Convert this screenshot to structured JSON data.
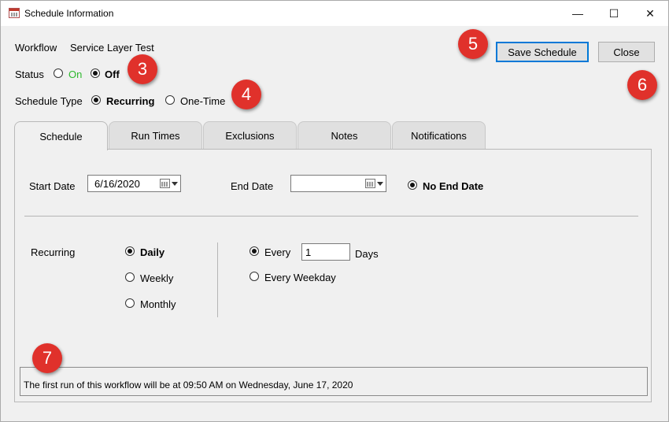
{
  "window": {
    "title": "Schedule Information",
    "controls": {
      "minimize": "—",
      "maximize": "☐",
      "close": "✕"
    }
  },
  "header": {
    "workflow_label": "Workflow",
    "workflow_value": "Service Layer Test",
    "status_label": "Status",
    "status_options": {
      "on": "On",
      "off": "Off"
    },
    "status_selected": "off",
    "schedule_type_label": "Schedule Type",
    "schedule_type_options": {
      "recurring": "Recurring",
      "one_time": "One-Time"
    },
    "schedule_type_selected": "recurring"
  },
  "buttons": {
    "save": "Save Schedule",
    "close": "Close"
  },
  "callouts": {
    "b3": "3",
    "b4": "4",
    "b5": "5",
    "b6": "6",
    "b7": "7"
  },
  "tabs": [
    "Schedule",
    "Run Times",
    "Exclusions",
    "Notes",
    "Notifications"
  ],
  "active_tab": "Schedule",
  "schedule": {
    "start_date_label": "Start Date",
    "start_date_value": "6/16/2020",
    "end_date_label": "End Date",
    "end_date_value": "",
    "no_end_date_label": "No End Date",
    "no_end_date_checked": true,
    "recurring_label": "Recurring",
    "frequency": {
      "daily": "Daily",
      "weekly": "Weekly",
      "monthly": "Monthly"
    },
    "frequency_selected": "daily",
    "every_label": "Every",
    "every_value": "1",
    "days_label": "Days",
    "every_weekday_label": "Every Weekday",
    "interval_selected": "every"
  },
  "status_message": "The first run of this workflow will be at 09:50 AM on Wednesday, June 17, 2020"
}
